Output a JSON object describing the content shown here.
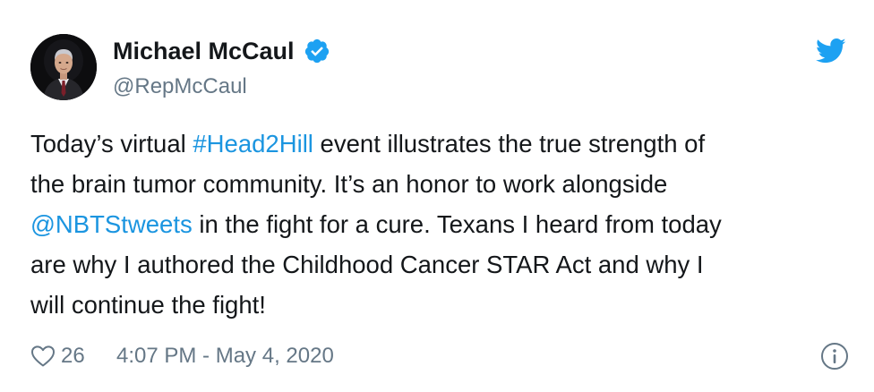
{
  "author": {
    "display_name": "Michael McCaul",
    "handle": "@RepMcCaul",
    "verified": true,
    "avatar": "portrait-photo"
  },
  "tweet": {
    "lines": [
      [
        {
          "text": "Today’s virtual ",
          "type": "text"
        },
        {
          "text": "#Head2Hill",
          "type": "hashtag"
        },
        {
          "text": " event illustrates the true strength of",
          "type": "text"
        }
      ],
      [
        {
          "text": "the brain tumor community. It’s an honor to work alongside",
          "type": "text"
        }
      ],
      [
        {
          "text": "@NBTStweets",
          "type": "mention"
        },
        {
          "text": " in the fight for a cure. Texans I heard from today",
          "type": "text"
        }
      ],
      [
        {
          "text": "are why I authored the Childhood Cancer STAR Act and why I",
          "type": "text"
        }
      ],
      [
        {
          "text": "will continue the fight!",
          "type": "text"
        }
      ]
    ]
  },
  "footer": {
    "like_count": "26",
    "timestamp": "4:07 PM - May 4, 2020"
  },
  "icons": {
    "brand": "twitter-bird-icon",
    "verified": "verified-badge-icon",
    "like": "heart-icon",
    "info": "info-icon"
  },
  "colors": {
    "link": "#1b95e0",
    "brand": "#1da1f2",
    "secondary_text": "#657786",
    "primary_text": "#14171a"
  }
}
